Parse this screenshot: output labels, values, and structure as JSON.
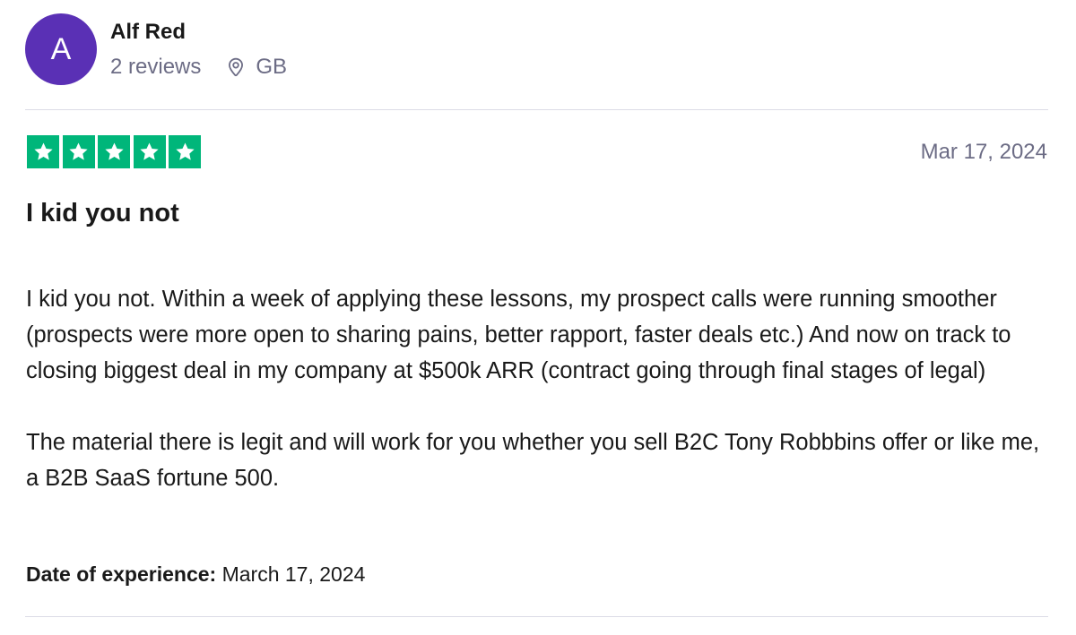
{
  "review": {
    "consumer": {
      "avatar_initial": "A",
      "name": "Alf Red",
      "reviews_count": "2 reviews",
      "location_icon": "location-pin-icon",
      "country": "GB"
    },
    "rating": {
      "stars": 5,
      "max_stars": 5,
      "star_icon": "star-icon",
      "color": "#00b67a"
    },
    "date": "Mar 17, 2024",
    "title": "I kid you not",
    "body": [
      "I kid you not. Within a week of applying these lessons, my prospect calls were running smoother (prospects were more open to sharing pains, better rapport, faster deals etc.) And now on track to closing biggest deal in my company at $500k ARR (contract going through final stages of legal)",
      "The material there is legit and will work for you whether you sell B2C Tony Robbbins offer or like me, a B2B SaaS fortune 500."
    ],
    "experience": {
      "label": "Date of experience:",
      "value": " March 17, 2024"
    }
  },
  "colors": {
    "avatar": "#5a30b5",
    "muted_text": "#6c6c85",
    "text": "#191919",
    "divider": "#dcdce6",
    "rating_green": "#00b67a"
  }
}
